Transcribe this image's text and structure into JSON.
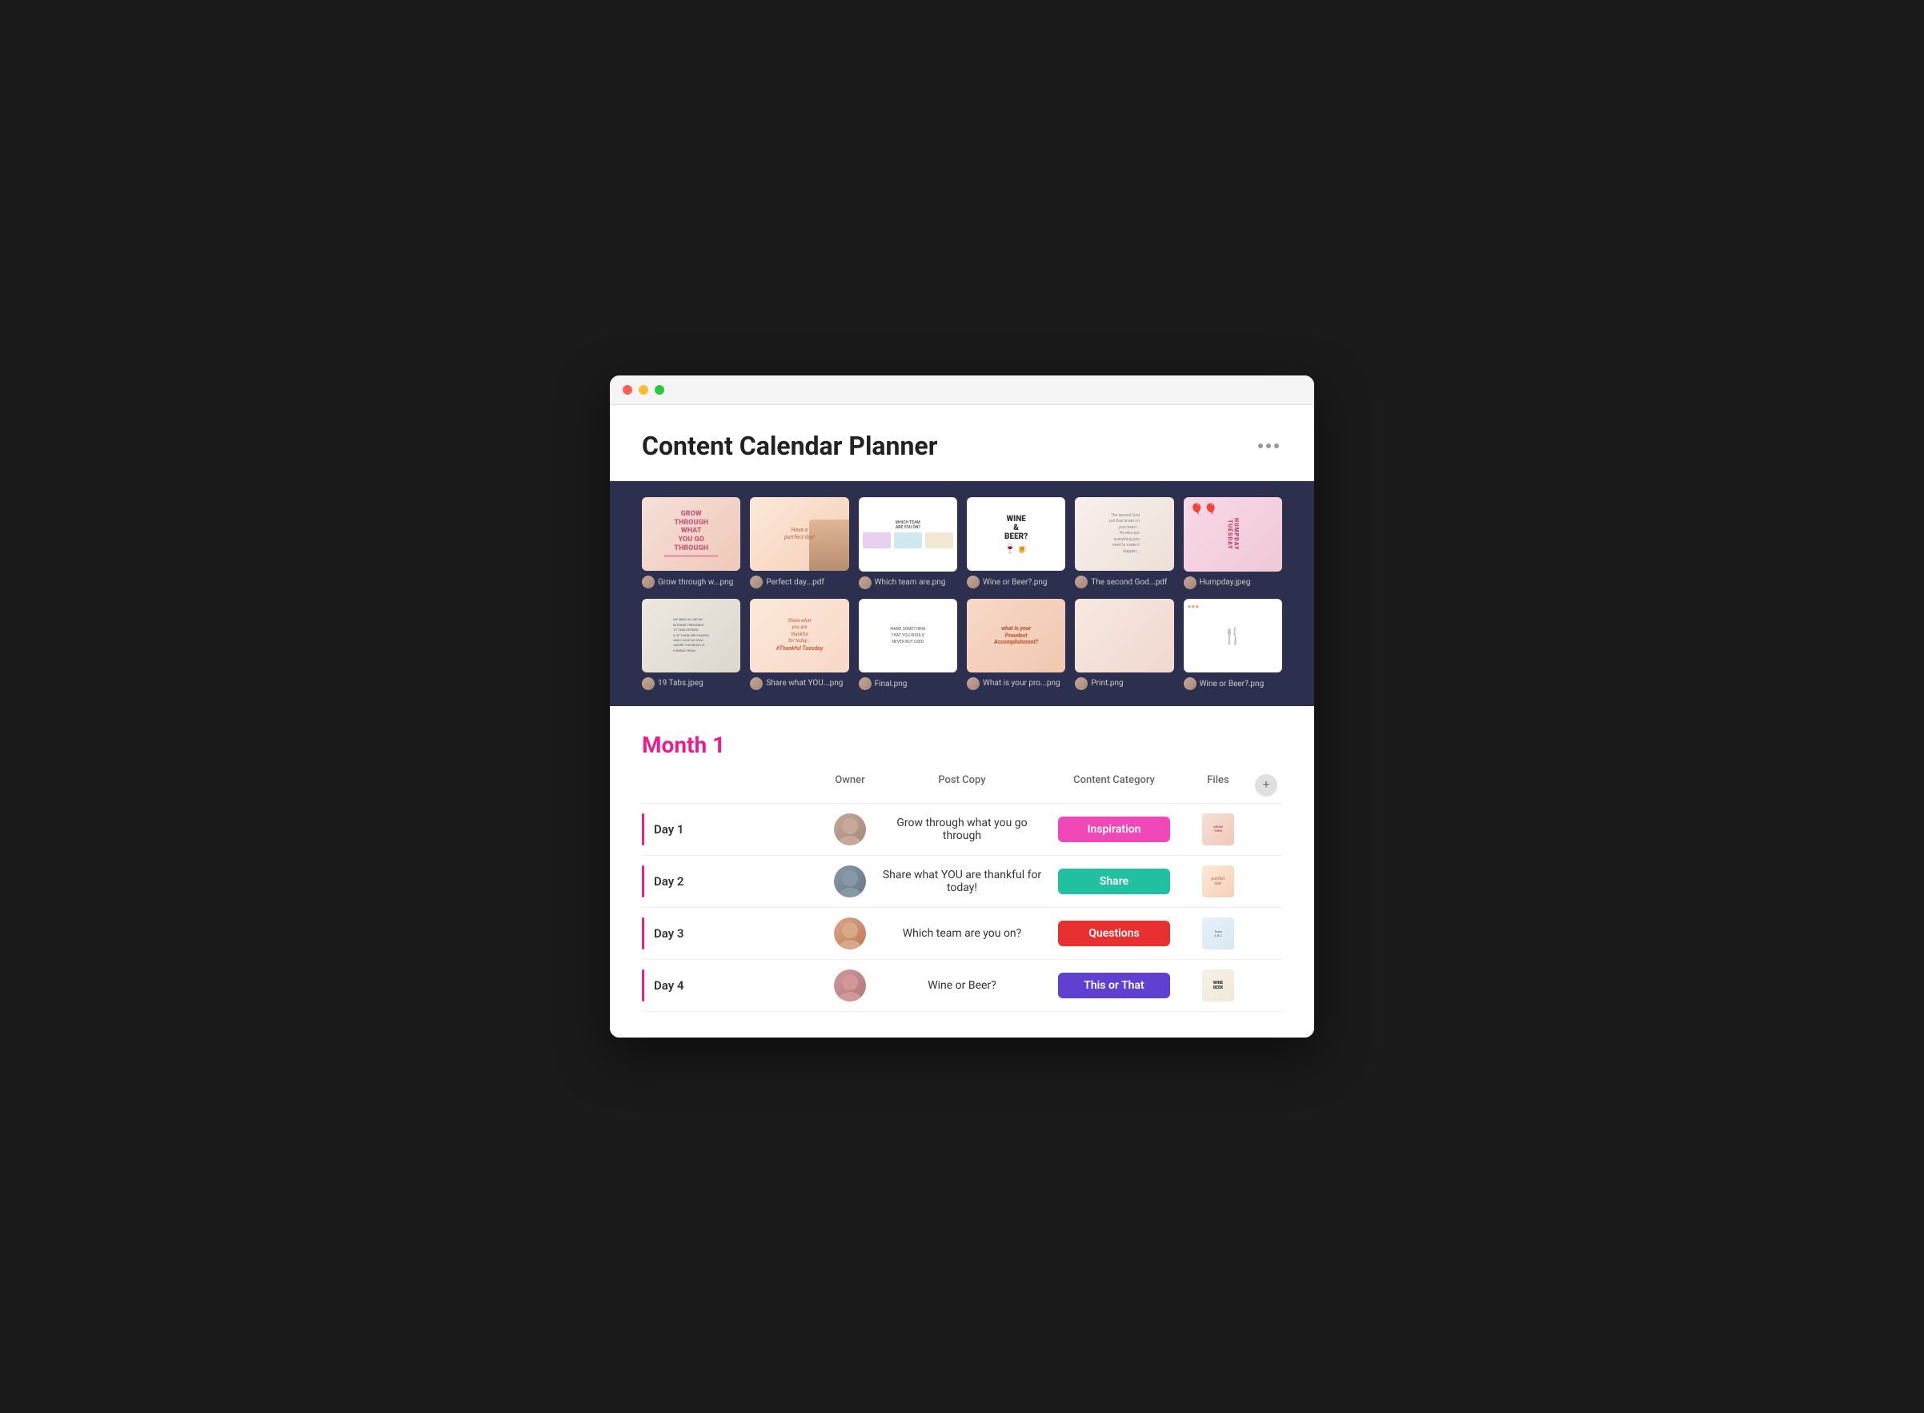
{
  "window": {
    "title": "Content Calendar Planner"
  },
  "header": {
    "title": "Content Calendar Planner",
    "more_button": "..."
  },
  "gallery": {
    "row1": [
      {
        "thumb_type": "grow",
        "filename": "Grow through w...png"
      },
      {
        "thumb_type": "cat",
        "filename": "Perfect day...pdf"
      },
      {
        "thumb_type": "team",
        "filename": "Which team are.png"
      },
      {
        "thumb_type": "wine",
        "filename": "Wine or Beer?.png"
      },
      {
        "thumb_type": "flower",
        "filename": "The second God...pdf"
      },
      {
        "thumb_type": "humpday",
        "filename": "Humpday.jpeg"
      }
    ],
    "row2": [
      {
        "thumb_type": "tabs",
        "filename": "19 Tabs.jpeg"
      },
      {
        "thumb_type": "thankful",
        "filename": "Share what YOU...png"
      },
      {
        "thumb_type": "final",
        "filename": "Final.png"
      },
      {
        "thumb_type": "proudest",
        "filename": "What is your pro...png"
      },
      {
        "thumb_type": "print",
        "filename": "Print.png"
      },
      {
        "thumb_type": "wine2",
        "filename": "Wine or Beer?.png"
      }
    ]
  },
  "table": {
    "month_label": "Month 1",
    "columns": [
      "",
      "Owner",
      "Post Copy",
      "Content Category",
      "Files",
      ""
    ],
    "rows": [
      {
        "day": "Day 1",
        "post_copy": "Grow through what you go through",
        "category": "Inspiration",
        "category_class": "badge-inspiration",
        "avatar_class": "avatar-1",
        "file_type": "grow"
      },
      {
        "day": "Day 2",
        "post_copy": "Share what YOU are thankful for today!",
        "category": "Share",
        "category_class": "badge-share",
        "avatar_class": "avatar-2",
        "file_type": "cat"
      },
      {
        "day": "Day 3",
        "post_copy": "Which team are you on?",
        "category": "Questions",
        "category_class": "badge-questions",
        "avatar_class": "avatar-3",
        "file_type": "team"
      },
      {
        "day": "Day 4",
        "post_copy": "Wine or Beer?",
        "category": "This or That",
        "category_class": "badge-this-or-that",
        "avatar_class": "avatar-4",
        "file_type": "wine"
      }
    ]
  }
}
